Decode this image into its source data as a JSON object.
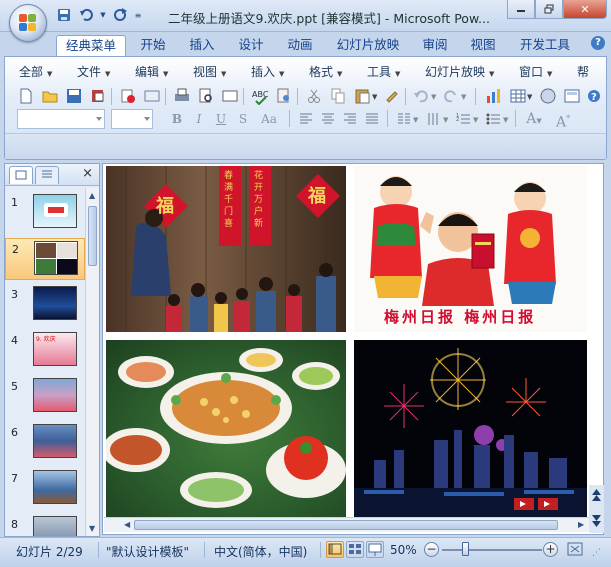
{
  "window": {
    "title": "二年级上册语文9.欢庆.ppt [兼容模式] - Microsoft Pow...",
    "minimize_icon": "minimize-icon",
    "restore_icon": "restore-icon",
    "close_icon": "close-icon"
  },
  "quick_access": [
    "save-icon",
    "undo-icon",
    "redo-icon",
    "customize-qat-icon"
  ],
  "ribbon_tabs": [
    {
      "label": "经典菜单",
      "active": true
    },
    {
      "label": "开始"
    },
    {
      "label": "插入"
    },
    {
      "label": "设计"
    },
    {
      "label": "动画"
    },
    {
      "label": "幻灯片放映"
    },
    {
      "label": "审阅"
    },
    {
      "label": "视图"
    },
    {
      "label": "开发工具"
    }
  ],
  "classic_menu": [
    "全部",
    "文件",
    "编辑",
    "视图",
    "插入",
    "格式",
    "工具",
    "幻灯片放映",
    "窗口",
    "帮"
  ],
  "format": {
    "bold": "B",
    "italic": "I",
    "underline": "U",
    "strike": "S",
    "case": "Aa",
    "grow": "A",
    "shrink": "A"
  },
  "panel": {
    "tab_slides": "slides-tab-icon",
    "tab_outline": "outline-tab-icon",
    "close": "×",
    "slide_numbers": [
      "1",
      "2",
      "3",
      "4",
      "5",
      "6",
      "7",
      "8"
    ],
    "selected_index": 1,
    "thumb4_text": "9. 欢庆"
  },
  "slide": {
    "photo_tl": "new-year-couplets-photo",
    "photo_tr": "child-with-red-envelope-photo",
    "photo_bl": "festive-banquet-photo",
    "photo_br": "fireworks-photo",
    "couplet_char": "福",
    "couplet_left": "春满千门喜",
    "couplet_right": "花开万户新",
    "newspaper_caption": "梅州日报  梅州日报"
  },
  "status": {
    "slide_info": "幻灯片 2/29",
    "theme": "\"默认设计模板\"",
    "language": "中文(简体，中国)",
    "zoom": "50%",
    "zoom_out": "−",
    "zoom_in": "+"
  },
  "colors": {
    "accent": "#15428b",
    "selected_thumb": "#f9c87a",
    "caption_red": "#d40b31"
  }
}
